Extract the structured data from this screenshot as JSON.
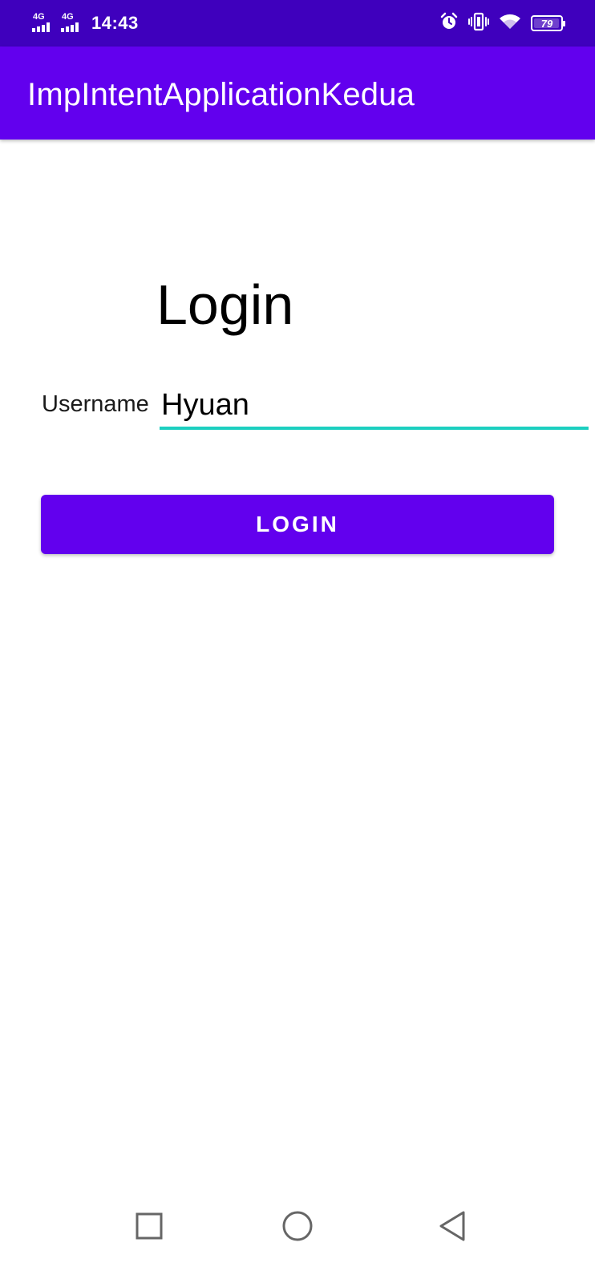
{
  "status_bar": {
    "signal_1": "4G",
    "signal_2": "4G",
    "time": "14:43",
    "battery_level": "79",
    "icons": [
      "alarm-icon",
      "vibrate-icon",
      "wifi-icon",
      "battery-icon"
    ]
  },
  "app_bar": {
    "title": "ImpIntentApplicationKedua"
  },
  "main": {
    "heading": "Login",
    "username_label": "Username",
    "username_value": "Hyuan",
    "login_button_label": "LOGIN"
  },
  "nav_bar": {
    "icons": [
      "recents-icon",
      "home-icon",
      "back-icon"
    ]
  },
  "colors": {
    "status_bar": "#3f00bd",
    "primary": "#6200ee",
    "input_accent": "#1ccfc0"
  }
}
